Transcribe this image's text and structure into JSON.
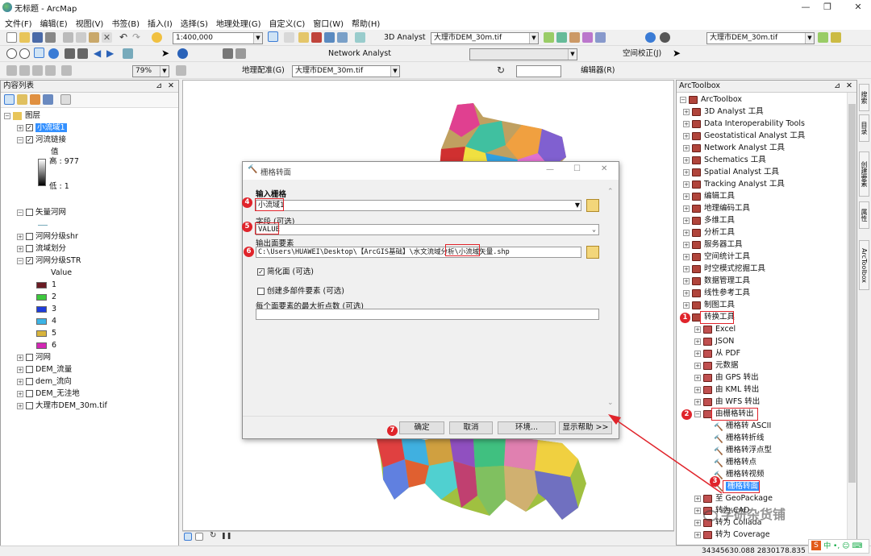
{
  "window": {
    "title": "无标题 - ArcMap"
  },
  "menu": [
    "文件(F)",
    "编辑(E)",
    "视图(V)",
    "书签(B)",
    "插入(I)",
    "选择(S)",
    "地理处理(G)",
    "自定义(C)",
    "窗口(W)",
    "帮助(H)"
  ],
  "toolbar1": {
    "scale": "1:400,000",
    "analyst3d": "3D Analyst",
    "layer3d": "大理市DEM_30m.tif",
    "layer_right": "大理市DEM_30m.tif"
  },
  "toolbar2": {
    "zoom": "79%",
    "network": "Network Analyst",
    "spatial_adj": "空间校正(J)"
  },
  "toolbar3": {
    "georef": "地理配准(G)",
    "georef_layer": "大理市DEM_30m.tif",
    "editor": "编辑器(R)"
  },
  "toc": {
    "title": "内容列表",
    "layers_root": "图层",
    "items": {
      "l1": "小流域1",
      "l2": "河流链接",
      "l2_value": "值",
      "l2_high": "高 : 977",
      "l2_low": "低 : 1",
      "l3": "矢量河网",
      "l4": "河网分级shr",
      "l5": "流域划分",
      "l6": "河网分级STR",
      "l6_value": "Value",
      "l6_classes": [
        {
          "label": "1",
          "color": "#6b1c24"
        },
        {
          "label": "2",
          "color": "#3cc83c"
        },
        {
          "label": "3",
          "color": "#1e3cdc"
        },
        {
          "label": "4",
          "color": "#3cb4e6"
        },
        {
          "label": "5",
          "color": "#d8b43c"
        },
        {
          "label": "6",
          "color": "#d228b4"
        }
      ],
      "l7": "河网",
      "l8": "DEM_流量",
      "l9": "dem_流向",
      "l10": "DEM_无洼地",
      "l11": "大理市DEM_30m.tif"
    }
  },
  "arctoolbox": {
    "title": "ArcToolbox",
    "root": "ArcToolbox",
    "top": [
      "3D Analyst 工具",
      "Data Interoperability Tools",
      "Geostatistical Analyst 工具",
      "Network Analyst 工具",
      "Schematics 工具",
      "Spatial Analyst 工具",
      "Tracking Analyst 工具",
      "编辑工具",
      "地理编码工具",
      "多维工具",
      "分析工具",
      "服务器工具",
      "空间统计工具",
      "时空模式挖掘工具",
      "数据管理工具",
      "线性参考工具",
      "制图工具"
    ],
    "conversion": "转换工具",
    "conv_children": [
      "Excel",
      "JSON",
      "从 PDF",
      "元数据",
      "由 GPS 转出",
      "由 KML 转出",
      "由 WFS 转出"
    ],
    "from_raster": "由栅格转出",
    "raster_tools": [
      "栅格转 ASCII",
      "栅格转折线",
      "栅格转浮点型",
      "栅格转点",
      "栅格转视频"
    ],
    "selected_tool": "栅格转面",
    "after": [
      "至 GeoPackage",
      "转为 CAD",
      "转为 Collada",
      "转为 Coverage"
    ]
  },
  "right_tabs": [
    "搜索",
    "目录",
    "创建要素",
    "属性",
    "ArcToolbox"
  ],
  "dialog": {
    "title": "栅格转面",
    "input_label": "输入栅格",
    "input_value": "小流域1",
    "field_label": "字段 (可选)",
    "field_value": "VALUE",
    "output_label": "输出面要素",
    "output_value": "C:\\Users\\HUAWEI\\Desktop\\【ArcGIS基础】\\水文流域分析\\小流域矢量.shp",
    "simplify_label": "简化面 (可选)",
    "simplify_checked": true,
    "multipart_label": "创建多部件要素 (可选)",
    "multipart_checked": false,
    "maxvert_label": "每个面要素的最大折点数 (可选)",
    "maxvert_value": "",
    "ok": "确定",
    "cancel": "取消",
    "env": "环境...",
    "help": "显示帮助 >>"
  },
  "steps": [
    "1",
    "2",
    "3",
    "4",
    "5",
    "6",
    "7"
  ],
  "status": {
    "coords": "34345630.088  2830178.835 米"
  },
  "watermark": "学研杂货铺"
}
